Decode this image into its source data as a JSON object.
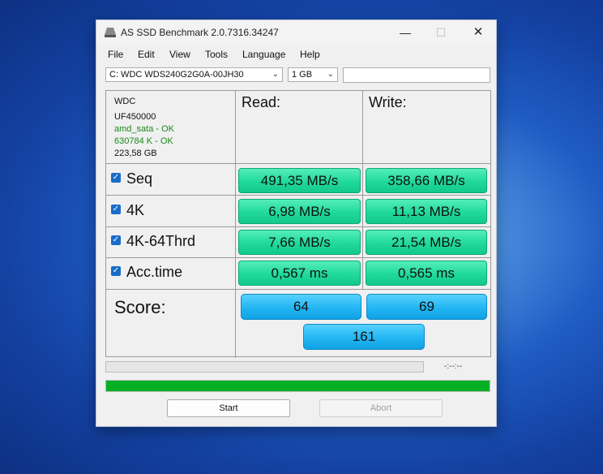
{
  "window": {
    "title": "AS SSD Benchmark 2.0.7316.34247",
    "minimize": "—",
    "maximize": "☐",
    "close": "✕"
  },
  "menu": [
    "File",
    "Edit",
    "View",
    "Tools",
    "Language",
    "Help"
  ],
  "drive_select": {
    "value": "C: WDC WDS240G2G0A-00JH30",
    "chevron": "⌄"
  },
  "size_select": {
    "value": "1 GB",
    "chevron": "⌄"
  },
  "drive_info": {
    "model": "WDC",
    "firmware": "UF450000",
    "driver": "amd_sata - OK",
    "alignment": "630784 K - OK",
    "capacity": "223,58 GB"
  },
  "columns": {
    "read": "Read:",
    "write": "Write:"
  },
  "tests": [
    {
      "label": "Seq",
      "read": "491,35 MB/s",
      "write": "358,66 MB/s",
      "checked": true
    },
    {
      "label": "4K",
      "read": "6,98 MB/s",
      "write": "11,13 MB/s",
      "checked": true
    },
    {
      "label": "4K-64Thrd",
      "read": "7,66 MB/s",
      "write": "21,54 MB/s",
      "checked": true
    },
    {
      "label": "Acc.time",
      "read": "0,567 ms",
      "write": "0,565 ms",
      "checked": true
    }
  ],
  "score": {
    "label": "Score:",
    "read": "64",
    "write": "69",
    "total": "161"
  },
  "progress": {
    "timer": "-:--:--",
    "total_fraction": 1.0
  },
  "buttons": {
    "start": "Start",
    "abort": "Abort"
  },
  "colors": {
    "value_green": "#1fd99b",
    "score_blue": "#21b6f2",
    "progress_green": "#06b025",
    "ok_text": "#1a8a1a"
  }
}
